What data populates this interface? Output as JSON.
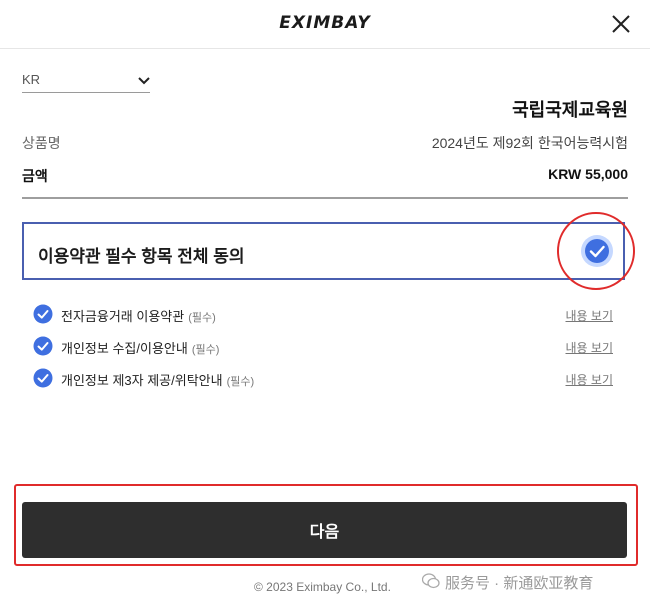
{
  "header": {
    "logo_text": "EXIMBAY",
    "close_icon": "close-icon"
  },
  "country": {
    "value": "KR",
    "icon": "chevron-down-icon"
  },
  "merchant": {
    "name": "국립국제교육원"
  },
  "order": {
    "product_label": "상품명",
    "product_value": "2024년도 제92회 한국어능력시험",
    "amount_label": "금액",
    "amount_value": "KRW 55,000"
  },
  "agree_all": {
    "label": "이용약관 필수 항목 전체 동의",
    "checked": true,
    "icon": "check-circle-icon"
  },
  "terms": [
    {
      "name": "전자금융거래 이용약관",
      "required": "(필수)",
      "view": "내용 보기",
      "checked": true
    },
    {
      "name": "개인정보 수집/이용안내",
      "required": "(필수)",
      "view": "내용 보기",
      "checked": true
    },
    {
      "name": "개인정보 제3자 제공/위탁안내",
      "required": "(필수)",
      "view": "내용 보기",
      "checked": true
    }
  ],
  "next_button": {
    "label": "다음"
  },
  "footer": {
    "copyright": "© 2023 Eximbay Co., Ltd."
  },
  "watermark": {
    "text": "服务号 · 新通欧亚教育"
  },
  "colors": {
    "accent": "#3f6fe0",
    "border_blue": "#4a5fb0",
    "button_dark": "#2e2e2e",
    "highlight_red": "#e02b2b"
  }
}
